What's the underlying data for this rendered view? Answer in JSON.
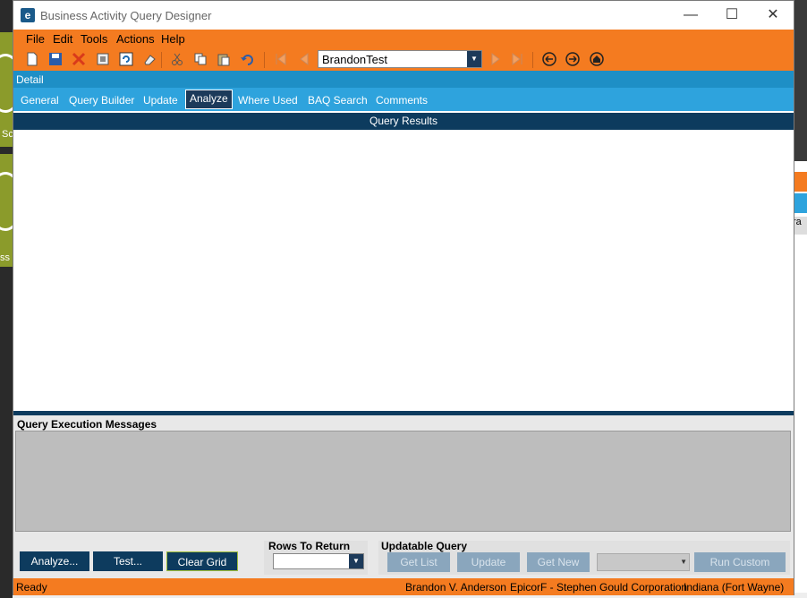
{
  "background": {
    "tile1_text": "Sc",
    "tile2_text": "ss",
    "right_text": "ra"
  },
  "window": {
    "title": "Business Activity Query Designer",
    "app_icon": "epicor-logo-icon"
  },
  "menu": [
    "File",
    "Edit",
    "Tools",
    "Actions",
    "Help"
  ],
  "toolbar": {
    "record_value": "BrandonTest"
  },
  "detail_label": "Detail",
  "tabs": [
    "General",
    "Query Builder",
    "Update",
    "Analyze",
    "Where Used",
    "BAQ Search",
    "Comments"
  ],
  "active_tab": "Analyze",
  "results_header": "Query Results",
  "messages_label": "Query Execution Messages",
  "buttons": {
    "analyze": "Analyze...",
    "test": "Test...",
    "clear_grid": "Clear Grid"
  },
  "rows_to_return": {
    "label": "Rows To Return",
    "value": ""
  },
  "updatable": {
    "label": "Updatable Query",
    "get_list": "Get List",
    "update": "Update",
    "get_new": "Get New",
    "run_custom": "Run Custom"
  },
  "status": {
    "state": "Ready",
    "user": "Brandon V. Anderson",
    "company": "EpicorF - Stephen Gould Corporation",
    "site": "Indiana (Fort Wayne)"
  },
  "colors": {
    "accent_orange": "#f47b20",
    "header_blue": "#2ea3dd",
    "dark_navy": "#0d3b5e"
  }
}
